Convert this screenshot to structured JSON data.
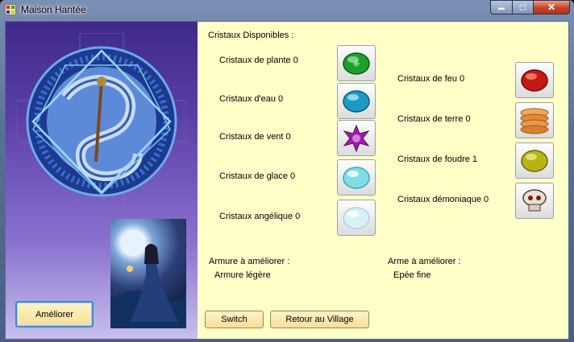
{
  "window": {
    "title": "Maison Hantée",
    "minimize_glyph": "▬",
    "maximize_glyph": "□",
    "close_glyph": "✕"
  },
  "crystals": {
    "heading": "Cristaux Disponibles :",
    "left": [
      {
        "label": "Cristaux de plante 0",
        "icon": "plant-crystal-icon",
        "color": "#1e9e2c"
      },
      {
        "label": "Cristaux d'eau 0",
        "icon": "water-crystal-icon",
        "color": "#1b9bc4"
      },
      {
        "label": "Cristaux de vent 0",
        "icon": "wind-crystal-icon",
        "color": "#9a1fa6"
      },
      {
        "label": "Cristaux de glace 0",
        "icon": "ice-crystal-icon",
        "color": "#7fdde8"
      },
      {
        "label": "Cristaux angélique 0",
        "icon": "angelic-crystal-icon",
        "color": "#d6f2f8"
      }
    ],
    "right": [
      {
        "label": "Cristaux de feu 0",
        "icon": "fire-crystal-icon",
        "color": "#c41a14"
      },
      {
        "label": "Cristaux de terre 0",
        "icon": "earth-crystal-icon",
        "color": "#e08a3a"
      },
      {
        "label": "Cristaux de foudre 1",
        "icon": "lightning-crystal-icon",
        "color": "#b8b414"
      },
      {
        "label": "Cristaux démoniaque 0",
        "icon": "demonic-crystal-icon",
        "color": "#7a5a4a"
      }
    ]
  },
  "upgrade": {
    "armor_heading": "Armure à améliorer :",
    "armor_value": "Armure légère",
    "weapon_heading": "Arme à améliorer :",
    "weapon_value": "Epée fine"
  },
  "buttons": {
    "improve": "Améliorer",
    "switch": "Switch",
    "back": "Retour au Village"
  },
  "colors": {
    "panel_bg": "#ffffc8",
    "button_bg": "#f5df9a",
    "focus_border": "#3b8ad6"
  }
}
